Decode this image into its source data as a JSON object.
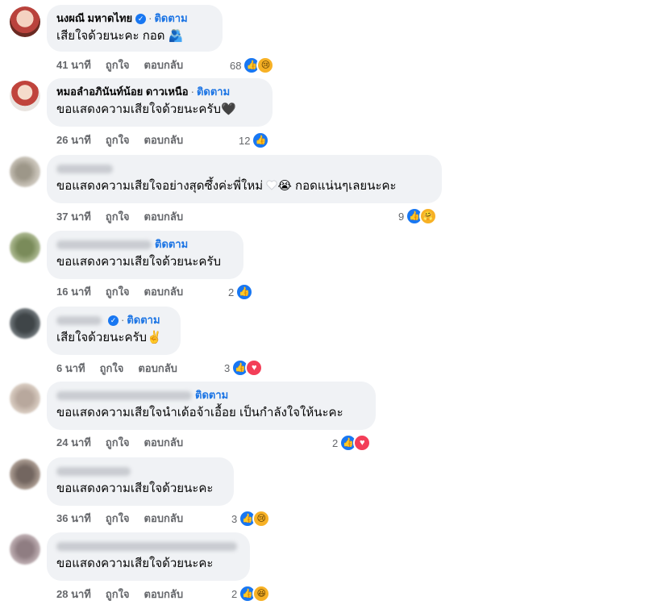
{
  "follow_label": "ติดตาม",
  "separator": "·",
  "actions": {
    "like": "ถูกใจ",
    "reply": "ตอบกลับ"
  },
  "colors": {
    "bubble": "#f0f2f5",
    "link": "#1b74e4",
    "meta": "#65676b",
    "like": "#1877f2",
    "love": "#f33e58"
  },
  "comments": [
    {
      "name": "นงผณี มหาดไทย",
      "verified": true,
      "text": "เสียใจด้วยนะคะ กอด",
      "emoji": "🫂",
      "time": "41 นาที",
      "reaction_count": "68",
      "reactions": [
        "like",
        "sad"
      ]
    },
    {
      "name": "หมอลำอภินันท์น้อย ดาวเหนือ",
      "verified": false,
      "text": "ขอแสดงความเสียใจด้วยนะครับ",
      "emoji": "🖤",
      "time": "26 นาที",
      "reaction_count": "12",
      "reactions": [
        "like"
      ]
    },
    {
      "name": "",
      "verified": false,
      "text": "ขอแสดงความเสียใจอย่างสุดซึ้งค่ะพี่ใหม่",
      "emoji": "😭",
      "text_after": "กอดแน่นๆเลยนะคะ",
      "time": "37 นาที",
      "reaction_count": "9",
      "reactions": [
        "like",
        "care"
      ]
    },
    {
      "name": "",
      "verified": false,
      "text": "ขอแสดงความเสียใจด้วยนะครับ",
      "time": "16 นาที",
      "reaction_count": "2",
      "reactions": [
        "like"
      ]
    },
    {
      "name": "",
      "verified": true,
      "text": "เสียใจด้วยนะครับ",
      "emoji": "✌️",
      "time": "6 นาที",
      "reaction_count": "3",
      "reactions": [
        "like",
        "love"
      ]
    },
    {
      "name": "",
      "verified": false,
      "text": "ขอแสดงความเสียใจนำเด้อจ้าเอื้อย เป็นกำลังใจให้นะคะ",
      "time": "24 นาที",
      "reaction_count": "2",
      "reactions": [
        "like",
        "love"
      ]
    },
    {
      "name": "",
      "verified": false,
      "text": "ขอแสดงความเสียใจด้วยนะคะ",
      "time": "36 นาที",
      "reaction_count": "3",
      "reactions": [
        "like",
        "sad"
      ]
    },
    {
      "name": "",
      "verified": false,
      "text": "ขอแสดงความเสียใจด้วยนะคะ",
      "time": "28 นาที",
      "reaction_count": "2",
      "reactions": [
        "like",
        "haha"
      ]
    }
  ]
}
